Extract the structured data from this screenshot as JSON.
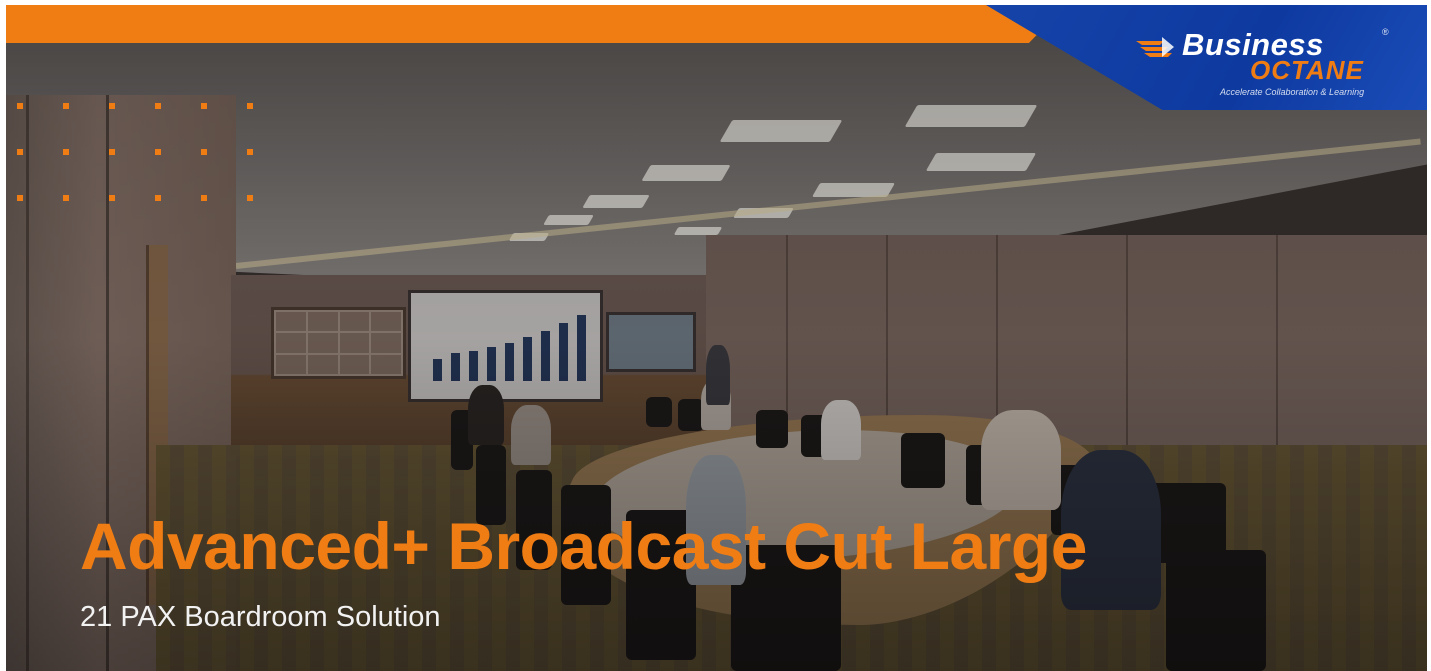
{
  "banner": {
    "headline": "Advanced+ Broadcast Cut Large",
    "subheadline": "21 PAX Boardroom Solution"
  },
  "logo": {
    "word_1": "Business",
    "word_2": "OCTANE",
    "registered_mark": "®",
    "tagline": "Accelerate Collaboration & Learning"
  },
  "theme": {
    "accent_orange": "#ef7d14",
    "brand_blue": "#1543a8",
    "subheadline_color": "#f2f2f2"
  },
  "decor": {
    "dot_grid_icon": "dot-grid-icon",
    "logo_flame_icon": "flame-icon"
  }
}
